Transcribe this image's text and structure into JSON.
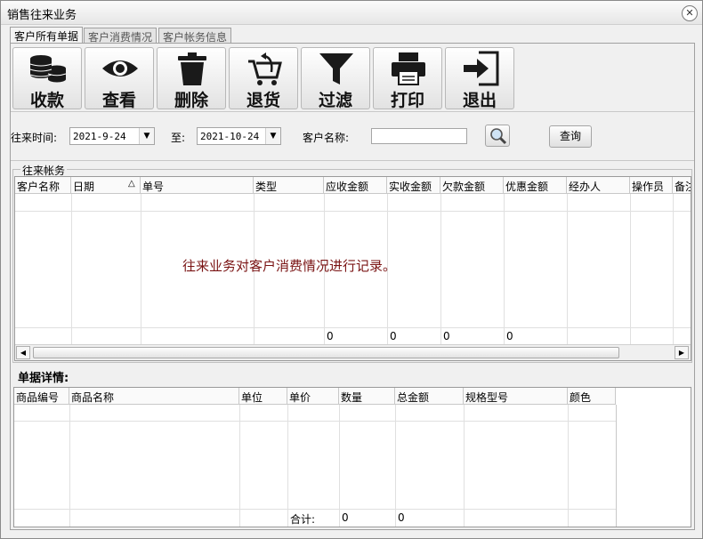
{
  "window": {
    "title": "销售往来业务",
    "close_label": "✕"
  },
  "tabs": [
    {
      "label": "客户所有单据",
      "active": true
    },
    {
      "label": "客户消费情况",
      "active": false
    },
    {
      "label": "客户帐务信息",
      "active": false
    }
  ],
  "toolbar": {
    "buttons": [
      {
        "label": "收款",
        "icon": "coins-icon"
      },
      {
        "label": "查看",
        "icon": "eye-icon"
      },
      {
        "label": "删除",
        "icon": "trash-icon"
      },
      {
        "label": "退货",
        "icon": "cart-return-icon"
      },
      {
        "label": "过滤",
        "icon": "funnel-icon"
      },
      {
        "label": "打印",
        "icon": "printer-icon"
      },
      {
        "label": "退出",
        "icon": "exit-icon"
      }
    ]
  },
  "filter": {
    "time_label": "往来时间:",
    "date_from": "2021-9-24",
    "to_label": "至:",
    "date_to": "2021-10-24",
    "customer_label": "客户名称:",
    "customer_value": "",
    "query_label": "查询",
    "search_icon": "magnifier-icon"
  },
  "ledger": {
    "group_title": "往来帐务",
    "columns": [
      "客户名称",
      "日期",
      "单号",
      "类型",
      "应收金额",
      "实收金额",
      "欠款金额",
      "优惠金额",
      "经办人",
      "操作员",
      "备注"
    ],
    "sort_indicator": "△",
    "empty_message": "往来业务对客户消费情况进行记录。",
    "totals": [
      "0",
      "0",
      "0",
      "0"
    ]
  },
  "detail": {
    "label": "单据详情:",
    "columns": [
      "商品编号",
      "商品名称",
      "单位",
      "单价",
      "数量",
      "总金额",
      "规格型号",
      "颜色"
    ],
    "total_label": "合计:",
    "totals": [
      "0",
      "0"
    ]
  }
}
